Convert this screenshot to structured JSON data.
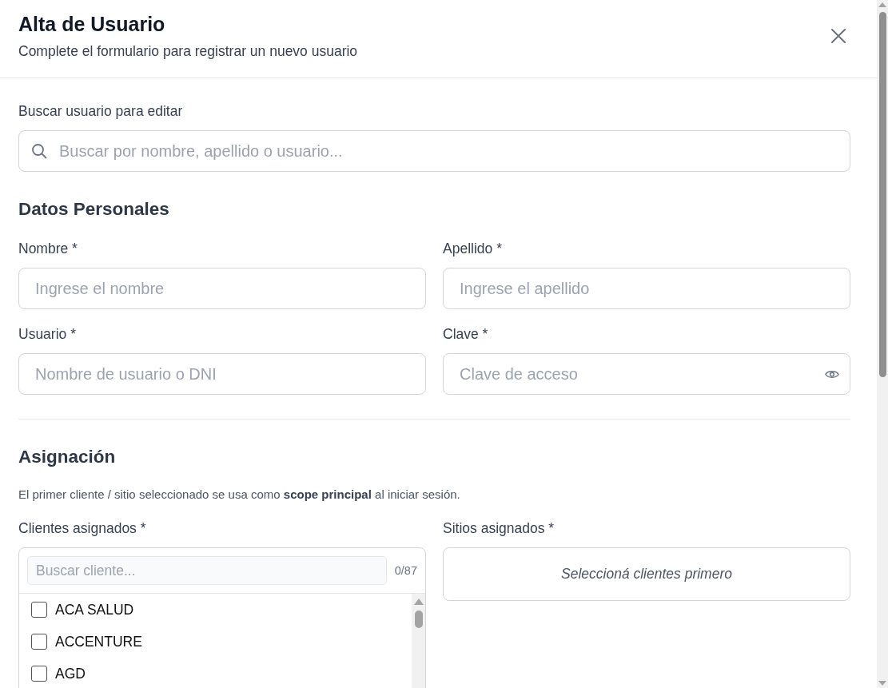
{
  "dialog": {
    "title": "Alta de Usuario",
    "subtitle": "Complete el formulario para registrar un nuevo usuario"
  },
  "user_search": {
    "label": "Buscar usuario para editar",
    "placeholder": "Buscar por nombre, apellido o usuario..."
  },
  "personal_data": {
    "heading": "Datos Personales",
    "fields": [
      {
        "label": "Nombre *",
        "placeholder": "Ingrese el nombre",
        "kind": "text"
      },
      {
        "label": "Apellido *",
        "placeholder": "Ingrese el apellido",
        "kind": "text"
      },
      {
        "label": "Usuario *",
        "placeholder": "Nombre de usuario o DNI",
        "kind": "text"
      },
      {
        "label": "Clave *",
        "placeholder": "Clave de acceso",
        "kind": "password"
      }
    ]
  },
  "assignment": {
    "heading": "Asignación",
    "note": "El primer cliente / sitio seleccionado se usa como **scope principal** al iniciar sesión.",
    "clients": {
      "label": "Clientes asignados *",
      "search_placeholder": "Buscar cliente...",
      "count": "0/87",
      "items": [
        {
          "label": "ACA SALUD",
          "checked": false
        },
        {
          "label": "ACCENTURE",
          "checked": false
        },
        {
          "label": "AGD",
          "checked": false
        }
      ]
    },
    "sites": {
      "label": "Sitios asignados *",
      "empty_message": "Seleccioná clientes primero"
    }
  }
}
